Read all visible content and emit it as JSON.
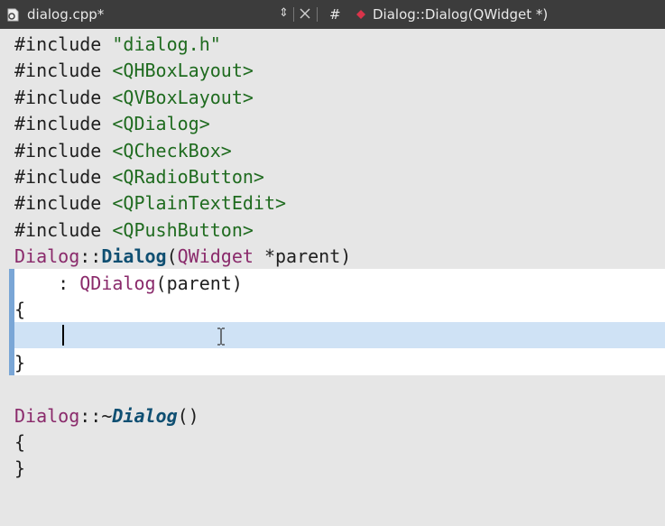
{
  "tab": {
    "file_name": "dialog.cpp*",
    "switch_arrows": "⇕",
    "hash_symbol": "#",
    "symbol_name": "Dialog::Dialog(QWidget *)"
  },
  "code": {
    "lines": [
      [
        {
          "t": "#include ",
          "k": "pre"
        },
        {
          "t": "\"dialog.h\"",
          "k": "str"
        }
      ],
      [
        {
          "t": "#include ",
          "k": "pre"
        },
        {
          "t": "<QHBoxLayout>",
          "k": "str"
        }
      ],
      [
        {
          "t": "#include ",
          "k": "pre"
        },
        {
          "t": "<QVBoxLayout>",
          "k": "str"
        }
      ],
      [
        {
          "t": "#include ",
          "k": "pre"
        },
        {
          "t": "<QDialog>",
          "k": "str"
        }
      ],
      [
        {
          "t": "#include ",
          "k": "pre"
        },
        {
          "t": "<QCheckBox>",
          "k": "str"
        }
      ],
      [
        {
          "t": "#include ",
          "k": "pre"
        },
        {
          "t": "<QRadioButton>",
          "k": "str"
        }
      ],
      [
        {
          "t": "#include ",
          "k": "pre"
        },
        {
          "t": "<QPlainTextEdit>",
          "k": "str"
        }
      ],
      [
        {
          "t": "#include ",
          "k": "pre"
        },
        {
          "t": "<QPushButton>",
          "k": "str"
        }
      ],
      [
        {
          "t": "Dialog",
          "k": "cls"
        },
        {
          "t": "::",
          "k": "op"
        },
        {
          "t": "Dialog",
          "k": "fn"
        },
        {
          "t": "(",
          "k": "par"
        },
        {
          "t": "QWidget",
          "k": "cls"
        },
        {
          "t": " *parent)",
          "k": "par"
        }
      ],
      [
        {
          "t": "    : ",
          "k": "op"
        },
        {
          "t": "QDialog",
          "k": "cls"
        },
        {
          "t": "(parent)",
          "k": "par"
        }
      ],
      [
        {
          "t": "{",
          "k": "par"
        }
      ],
      [
        {
          "t": "",
          "k": "par"
        }
      ],
      [
        {
          "t": "}",
          "k": "par"
        }
      ],
      [
        {
          "t": "",
          "k": "par"
        }
      ],
      [
        {
          "t": "Dialog",
          "k": "cls"
        },
        {
          "t": "::~",
          "k": "op"
        },
        {
          "t": "Dialog",
          "k": "fni"
        },
        {
          "t": "()",
          "k": "par"
        }
      ],
      [
        {
          "t": "{",
          "k": "par"
        }
      ],
      [
        {
          "t": "}",
          "k": "par"
        }
      ]
    ]
  },
  "colors": {
    "tab_bar": "#3c3c3c",
    "editor_bg": "#e6e6e6",
    "block_bg": "#ffffff",
    "current_line": "#cfe2f5",
    "string": "#1f6b1f",
    "class": "#8a2a6b",
    "function": "#0f4f72"
  }
}
